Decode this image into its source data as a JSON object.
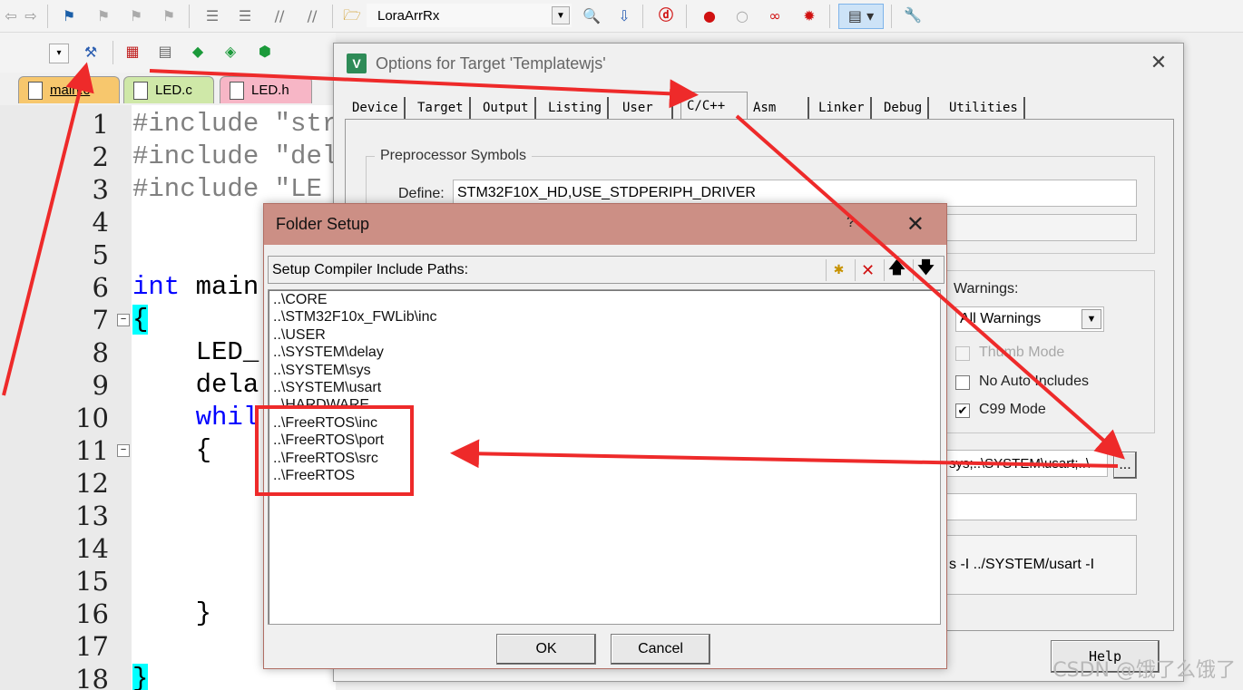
{
  "toolbar": {
    "target_name": "LoraArrRx"
  },
  "file_tabs": [
    "main.c",
    "LED.c",
    "LED.h"
  ],
  "editor": {
    "line_numbers": [
      "1",
      "2",
      "3",
      "4",
      "5",
      "6",
      "7",
      "8",
      "9",
      "10",
      "11",
      "12",
      "13",
      "14",
      "15",
      "16",
      "17",
      "18"
    ],
    "lines": {
      "l1a": "#include ",
      "l1b": "\"str",
      "l2a": "#include ",
      "l2b": "\"del",
      "l3a": "#include ",
      "l3b": "\"LE",
      "l6a": "int",
      "l6b": " main",
      "l7": "{",
      "l8": "    LED_",
      "l9": "    dela",
      "l10": "    whil",
      "l11": "    {",
      "l16": "    }",
      "l18": "}"
    }
  },
  "options_dialog": {
    "title": "Options for Target 'Templatewjs'",
    "tabs": [
      "Device",
      "Target",
      "Output",
      "Listing",
      "User",
      "C/C++",
      "Asm",
      "Linker",
      "Debug",
      "Utilities"
    ],
    "active_tab": "C/C++",
    "preprocessor_title": "Preprocessor Symbols",
    "define_label": "Define:",
    "define_value": "STM32F10X_HD,USE_STDPERIPH_DRIVER",
    "warnings_label": "Warnings:",
    "warnings_value": "All Warnings",
    "thumb_mode": "Thumb Mode",
    "no_auto_includes": "No Auto Includes",
    "c99_mode": "C99 Mode",
    "include_paths_value": "sys;..\\SYSTEM\\usart;..\\",
    "browse_button": "...",
    "compiler_string": "s -I ../SYSTEM/usart -I",
    "help_button": "Help"
  },
  "folder_setup": {
    "title": "Folder Setup",
    "help_glyph": "?",
    "header_label": "Setup Compiler Include Paths:",
    "paths": [
      "..\\CORE",
      "..\\STM32F10x_FWLib\\inc",
      "..\\USER",
      "..\\SYSTEM\\delay",
      "..\\SYSTEM\\sys",
      "..\\SYSTEM\\usart",
      "..\\HARDWARE",
      "..\\FreeRTOS\\inc",
      "..\\FreeRTOS\\port",
      "..\\FreeRTOS\\src",
      "..\\FreeRTOS"
    ],
    "ok_label": "OK",
    "cancel_label": "Cancel"
  },
  "watermark": "CSDN @饿了么饿了",
  "colors": {
    "annotation_red": "#ee2a2a",
    "folder_setup_title_bar": "#cc8f85",
    "keyword_blue": "#0000ff",
    "preprocessor_gray": "#808080",
    "brace_highlight": "#00ffff"
  }
}
